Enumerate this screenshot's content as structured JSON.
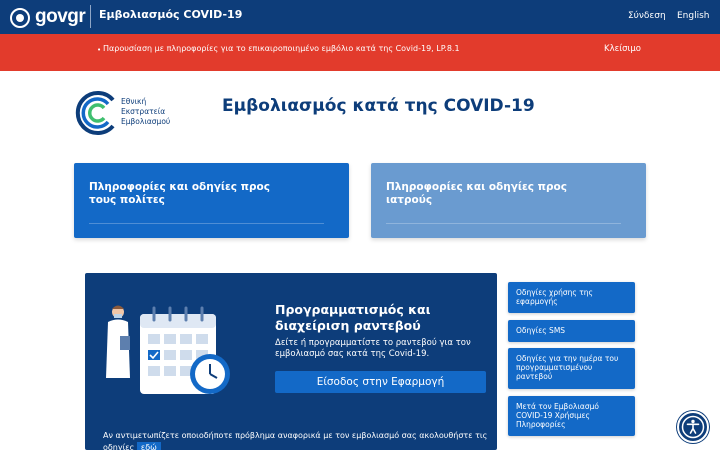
{
  "header": {
    "logo": "govgr",
    "app_title": "Εμβολιασμός COVID-19",
    "login": "Σύνδεση",
    "language": "English"
  },
  "banner": {
    "text": "Παρουσίαση με πληροφορίες για το επικαιροποιημένο εμβόλιο κατά της Covid-19, LP.8.1",
    "close": "Κλείσιμο",
    "background": "#e23b2c"
  },
  "campaign": {
    "line1": "Εθνική",
    "line2": "Εκστρατεία",
    "line3": "Εμβολιασμού"
  },
  "page_title": "Εμβολιασμός κατά της COVID-19",
  "cards": {
    "citizens": "Πληροφορίες και οδηγίες προς τους πολίτες",
    "doctors": "Πληροφορίες και οδηγίες προς ιατρούς"
  },
  "app_panel": {
    "title": "Προγραμματισμός και διαχείριση ραντεβού",
    "description": "Δείτε ή προγραμματίστε το ραντεβού για τον εμβολιασμό σας κατά της Covid-19.",
    "button": "Είσοδος στην Εφαρμογή",
    "footer": "Αν αντιμετωπίζετε οποιοδήποτε πρόβλημα αναφορικά με τον εμβολιασμό σας ακολουθήστε τις οδηγίες",
    "footer_link": "εδώ"
  },
  "side_links": [
    "Οδηγίες χρήσης της εφαρμογής",
    "Οδηγίες SMS",
    "Οδηγίες για την ημέρα του προγραμματισμένου ραντεβού",
    "Μετά τον Εμβολιασμό COVID-19 Χρήσιμες Πληροφορίες"
  ],
  "colors": {
    "primary": "#0d3d7a",
    "accent": "#1369c7",
    "card_light": "#6a9bd0",
    "green": "#3fbf6f"
  },
  "icons": {
    "gov_seal": "gov-seal-icon",
    "campaign": "campaign-logo-icon",
    "accessibility": "accessibility-icon"
  }
}
